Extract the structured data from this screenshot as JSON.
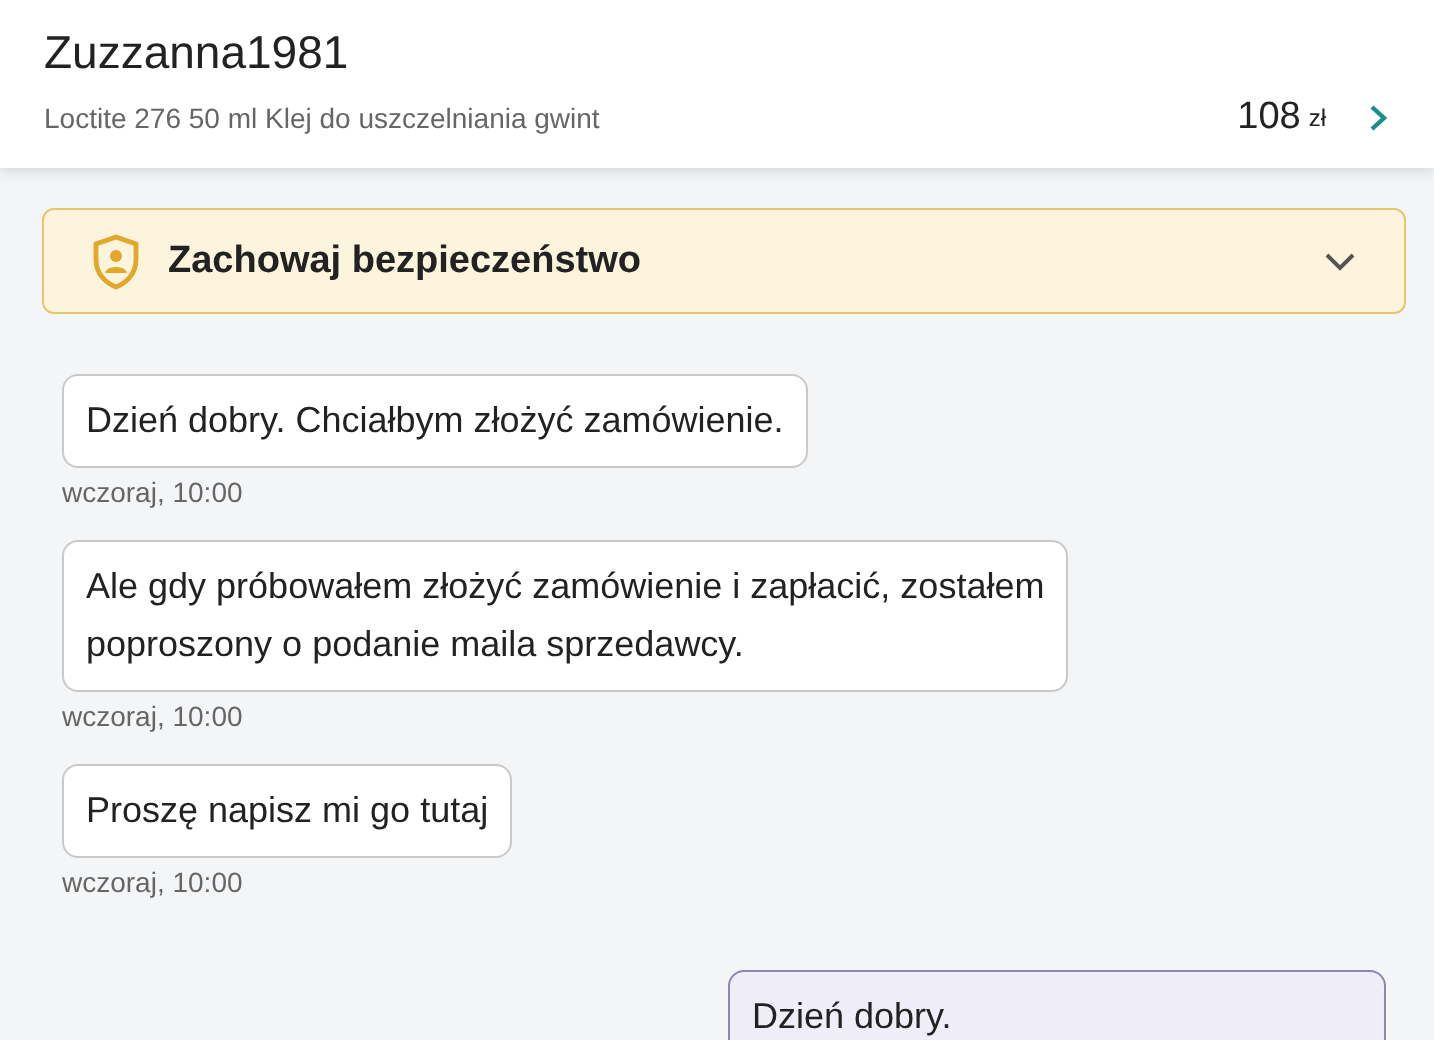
{
  "header": {
    "user": "Zuzzanna1981",
    "product": "Loctite 276 50 ml Klej do uszczelniania gwint",
    "price": "108",
    "currency": "zł"
  },
  "safety_banner": {
    "title": "Zachowaj bezpieczeństwo",
    "expanded": false
  },
  "messages": [
    {
      "kind": "incoming",
      "lines": [
        "Dzień dobry. Chciałbym złożyć zamówienie."
      ],
      "time": "wczoraj, 10:00"
    },
    {
      "kind": "incoming",
      "lines": [
        "Ale gdy próbowałem złożyć zamówienie i zapłacić, zostałem",
        "poproszony o podanie maila sprzedawcy."
      ],
      "time": "wczoraj, 10:00"
    },
    {
      "kind": "incoming",
      "lines": [
        "Proszę napisz mi go tutaj"
      ],
      "time": "wczoraj, 10:00"
    },
    {
      "kind": "outgoing",
      "lines": [
        "Dzień dobry."
      ]
    }
  ]
}
